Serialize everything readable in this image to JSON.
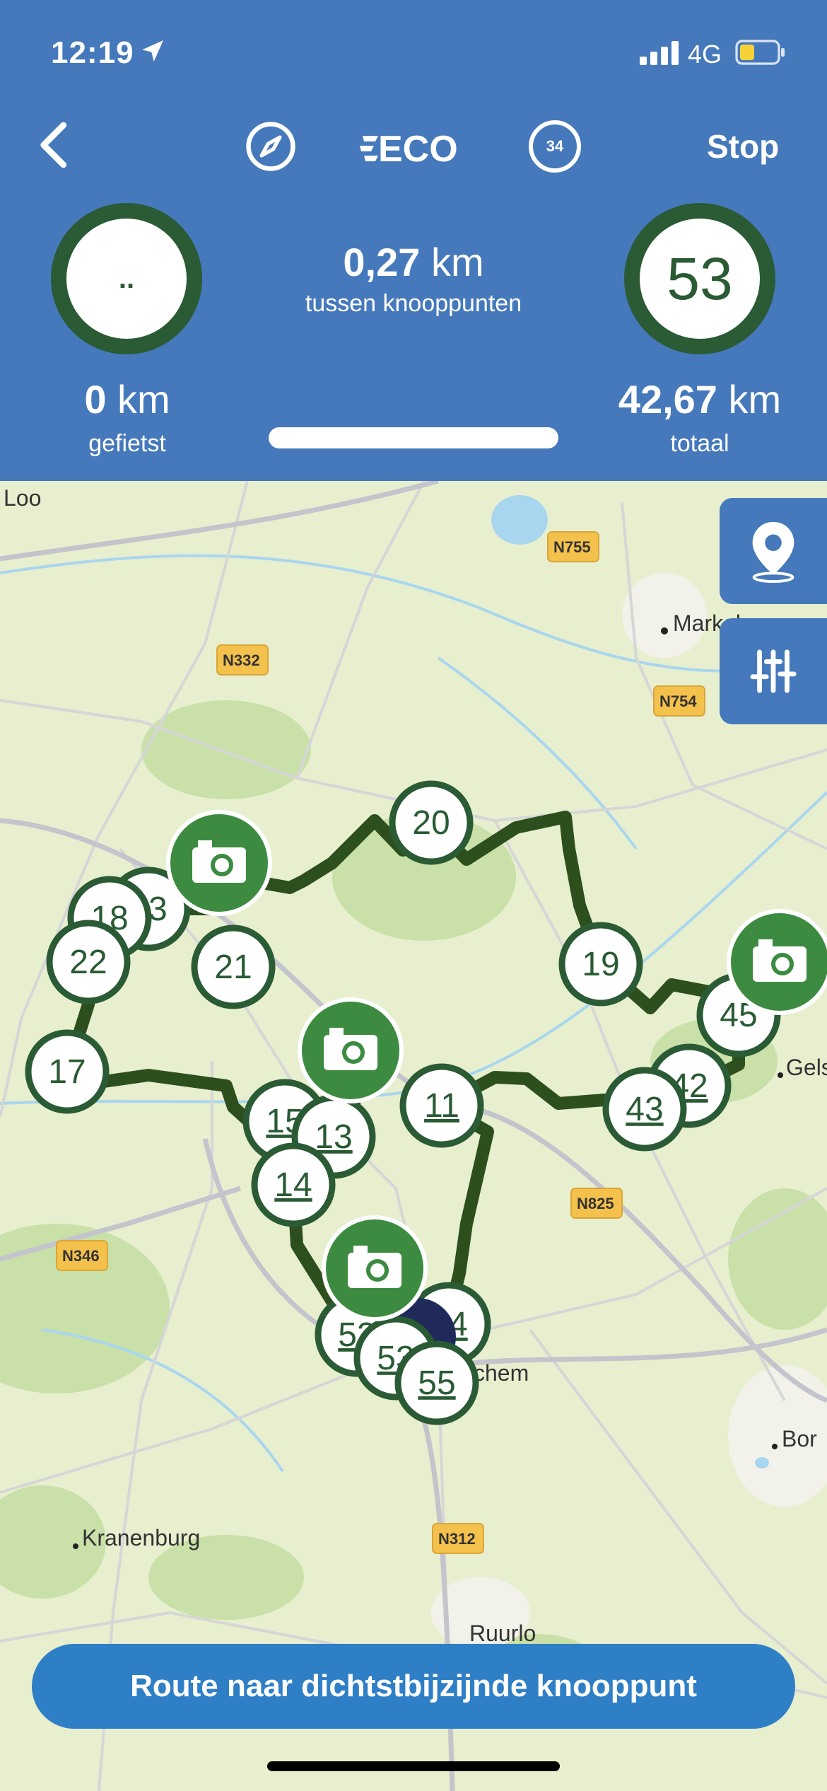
{
  "status": {
    "time": "12:19",
    "network": "4G"
  },
  "header": {
    "stop_label": "Stop",
    "logo_text": "ECO",
    "counter_badge": "34",
    "current_node": "..",
    "next_node": "53",
    "between_km_value": "0,27",
    "between_km_unit": "km",
    "between_label": "tussen knooppunten",
    "cycled_value": "0",
    "cycled_unit": "km",
    "cycled_label": "gefietst",
    "total_value": "42,67",
    "total_unit": "km",
    "total_label": "totaal"
  },
  "map": {
    "places": [
      "Loo",
      "Markelo",
      "Gels",
      "chem",
      "Bor",
      "Kranenburg",
      "Ruurlo",
      "l"
    ],
    "roads": [
      "N755",
      "N332",
      "N754",
      "N825",
      "N346",
      "N312"
    ],
    "nodes": [
      "20",
      "19",
      "45",
      "42",
      "43",
      "11",
      "13",
      "15",
      "14",
      "17",
      "18",
      "23",
      "22",
      "21",
      "54",
      "53",
      "55"
    ],
    "colors": {
      "route": "#2d4f1e",
      "node_ring": "#2a5b34",
      "photo": "#3c8b40",
      "water": "#a9d6ef"
    }
  },
  "actions": {
    "route_button": "Route naar dichtstbijzijnde knooppunt"
  }
}
